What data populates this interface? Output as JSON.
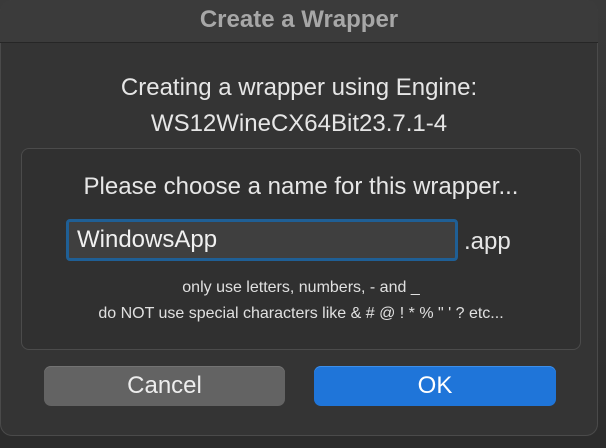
{
  "window": {
    "title": "Create a Wrapper"
  },
  "engine": {
    "line1": "Creating a wrapper using Engine:",
    "line2": "WS12WineCX64Bit23.7.1-4"
  },
  "form": {
    "prompt": "Please choose a name for this wrapper...",
    "name_value": "WindowsApp",
    "extension": ".app",
    "hint_line1": "only use letters, numbers, - and _",
    "hint_line2": "do NOT use special characters like & # @ ! * % \" ' ? etc..."
  },
  "buttons": {
    "cancel_label": "Cancel",
    "ok_label": "OK"
  },
  "colors": {
    "accent": "#1f75d9",
    "focus_ring": "#1f5f95",
    "dialog_background": "#343434"
  }
}
